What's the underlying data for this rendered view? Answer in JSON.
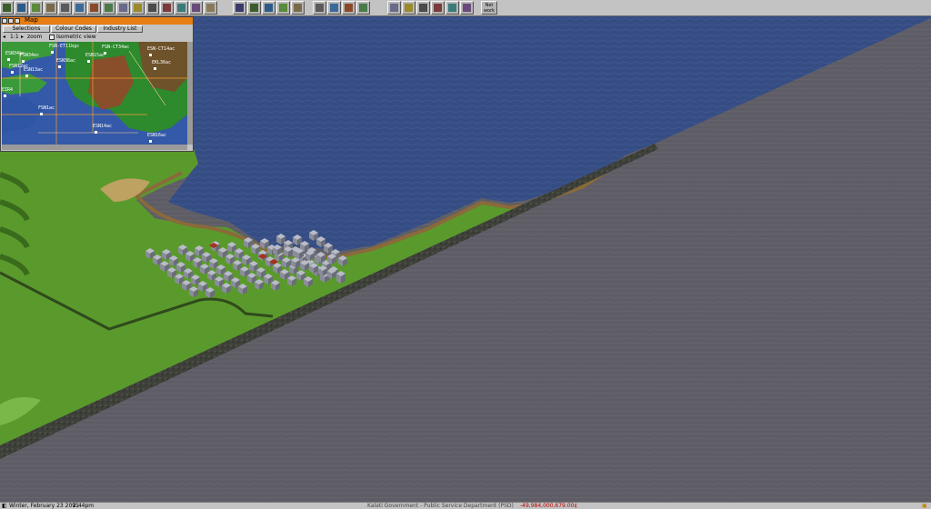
{
  "map_window": {
    "title": "Map",
    "buttons": [
      "Selections",
      "Colour Codes",
      "Industry List"
    ],
    "zoom_value": "1:1",
    "zoom_label": "zoom",
    "isometric_label": "Isometric view",
    "station_labels": [
      "FSN-ET11bgc",
      "FSN-CT34ac",
      "ESN-CT14ac",
      "ESN34ac",
      "FSN34ec",
      "ESN15ac",
      "ESN36ac",
      "FSN12ac",
      "ESN13ac",
      "EKL36ac",
      "EIR4",
      "ESN14ac",
      "ESN16ac",
      "FSN1ac"
    ]
  },
  "toolbar": {
    "net_button_label": "Net\nwork"
  },
  "status_bar": {
    "date": "Winter, February 23 2091",
    "time": "2:44pm",
    "company": "Kalati Government - Public Service Department (PSD)",
    "money": "-49,984,000,679.00¢"
  },
  "colors": {
    "water": "#364d84",
    "grass": "#5a9a2c",
    "unexplored": "#5e5d66",
    "cliff": "#3e403a",
    "title_bar": "#e67e14",
    "money_negative": "#b40000"
  }
}
